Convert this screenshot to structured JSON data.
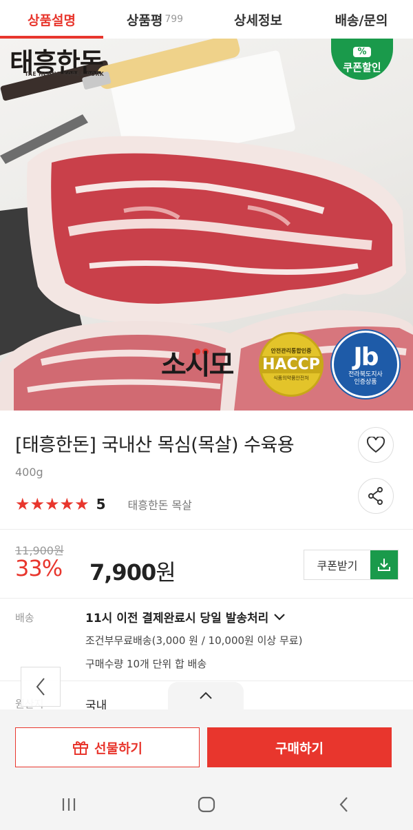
{
  "tabs": [
    {
      "label": "상품설명",
      "active": true
    },
    {
      "label": "상품평",
      "count": "799"
    },
    {
      "label": "상세정보"
    },
    {
      "label": "배송/문의"
    }
  ],
  "hero": {
    "logo_text": "태흥한돈",
    "logo_sub": "TAE HEUNG KOREA PORK",
    "coupon_badge": {
      "pct": "%",
      "label": "쿠폰할인"
    },
    "brand_mark": "소시모",
    "haccp": {
      "top": "안전관리통합인증",
      "mark": "HACCP",
      "bottom": "식품의약품안전처"
    },
    "jb": {
      "mark": "Jb",
      "caption_line1": "전라북도지사",
      "caption_line2": "인증상품"
    }
  },
  "product": {
    "title": "[태흥한돈] 국내산 목심(목살) 수육용",
    "weight": "400g",
    "rating": "5",
    "stars": 5,
    "keyword": "태흥한돈 목살"
  },
  "price": {
    "original": "11,900원",
    "discount": "33%",
    "amount": "7,900",
    "unit": "원",
    "coupon_button": "쿠폰받기"
  },
  "shipping": {
    "label": "배송",
    "main": "11시 이전 결제완료시 당일 발송처리",
    "line1": "조건부무료배송(3,000 원 / 10,000원 이상 무료)",
    "line2": "구매수량 10개 단위 합 배송"
  },
  "origin": {
    "label": "원산지",
    "value": "국내"
  },
  "buy_bar": {
    "gift_label": "선물하기",
    "buy_label": "구매하기"
  },
  "icons": {
    "favorite": "heart-icon",
    "share": "share-icon",
    "download": "download-icon",
    "gift": "gift-icon",
    "chevron_down": "chevron-down-icon",
    "prev": "chevron-left-icon",
    "collapse": "chevron-up-icon",
    "nav_recent": "recent-apps-icon",
    "nav_home": "home-icon",
    "nav_back": "back-icon"
  },
  "colors": {
    "accent": "#e8362d",
    "coupon_green": "#1a9a4b"
  }
}
